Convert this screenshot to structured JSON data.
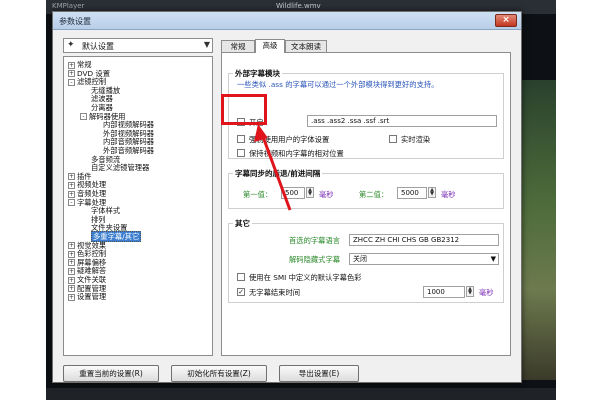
{
  "window": {
    "app_name": "KMPlayer",
    "file_name": "Wildlife.wmv",
    "dialog_title": "参数设置",
    "close_symbol": "×"
  },
  "preset": {
    "lead_symbol": "✦",
    "value": "默认设置",
    "arrow": "▼"
  },
  "tree": [
    {
      "label": "常规",
      "box": "+"
    },
    {
      "label": "DVD 设置",
      "box": "+"
    },
    {
      "label": "滤镜控制",
      "box": "-"
    },
    {
      "label": "无缝播放",
      "box": ""
    },
    {
      "label": "滤波器",
      "box": ""
    },
    {
      "label": "分离器",
      "box": ""
    },
    {
      "label": "解码器使用",
      "box": "-"
    },
    {
      "label": "内部视频解码器",
      "box": ""
    },
    {
      "label": "外部视频解码器",
      "box": ""
    },
    {
      "label": "内部音频解码器",
      "box": ""
    },
    {
      "label": "外部音频解码器",
      "box": ""
    },
    {
      "label": "多音频流",
      "box": ""
    },
    {
      "label": "自定义滤镜管理器",
      "box": ""
    },
    {
      "label": "插件",
      "box": "+"
    },
    {
      "label": "视频处理",
      "box": "+"
    },
    {
      "label": "音频处理",
      "box": "+"
    },
    {
      "label": "字幕处理",
      "box": "-"
    },
    {
      "label": "字体样式",
      "box": ""
    },
    {
      "label": "排列",
      "box": ""
    },
    {
      "label": "文件夹设置",
      "box": ""
    },
    {
      "label": "多重字幕/其它",
      "box": ""
    },
    {
      "label": "视觉效果",
      "box": "+"
    },
    {
      "label": "色彩控制",
      "box": "+"
    },
    {
      "label": "屏幕偏移",
      "box": "+"
    },
    {
      "label": "疑难解答",
      "box": "+"
    },
    {
      "label": "文件关联",
      "box": "+"
    },
    {
      "label": "配置管理",
      "box": "+"
    },
    {
      "label": "设置管理",
      "box": "+"
    }
  ],
  "tabs": [
    {
      "label": "常规"
    },
    {
      "label": "高级"
    },
    {
      "label": "文本朗读"
    }
  ],
  "external_module": {
    "title": "外部字幕模块",
    "description": "一些类似 .ass 的字幕可以通过一个外部模块得到更好的支持。",
    "enable_label": "开启",
    "enable_checked": "",
    "formats": ".ass .ass2 .ssa .ssf .srt",
    "force_user_font_label": "强制使用用户的字体设置",
    "force_user_font_checked": "",
    "realtime_render_label": "实时渲染",
    "realtime_render_checked": "",
    "keep_relative_pos_label": "保持视频和内字幕的相对位置",
    "keep_relative_pos_checked": ""
  },
  "sync": {
    "title": "字幕同步的后退/前进间隔",
    "first_label": "第一值：",
    "first_value": "500",
    "first_unit": "毫秒",
    "second_label": "第二值：",
    "second_value": "5000",
    "second_unit": "毫秒",
    "spin_up": "▲",
    "spin_down": "▼"
  },
  "other": {
    "title": "其它",
    "preferred_lang_label": "首选的字幕语言",
    "preferred_lang_value": "ZHCC ZH CHI CHS GB GB2312",
    "decode_mode_label": "解码隐藏式字幕",
    "decode_mode_value": "关闭",
    "smi_color_label": "使用在 SMI 中定义的默认字幕色彩",
    "smi_color_checked": "",
    "no_sub_end_label": "无字幕结束时间",
    "no_sub_end_checked": "✓",
    "no_sub_end_value": "1000",
    "no_sub_end_unit": "毫秒"
  },
  "buttons": {
    "reset_current": "重置当前的设置(R)",
    "reset_all": "初始化所有设置(Z)",
    "export": "导出设置(E)"
  },
  "colors": {
    "highlight_red": "#e0151b",
    "link_blue": "#2b55b8",
    "label_green": "#2a8a2a",
    "unit_purple": "#7a2cb5"
  }
}
